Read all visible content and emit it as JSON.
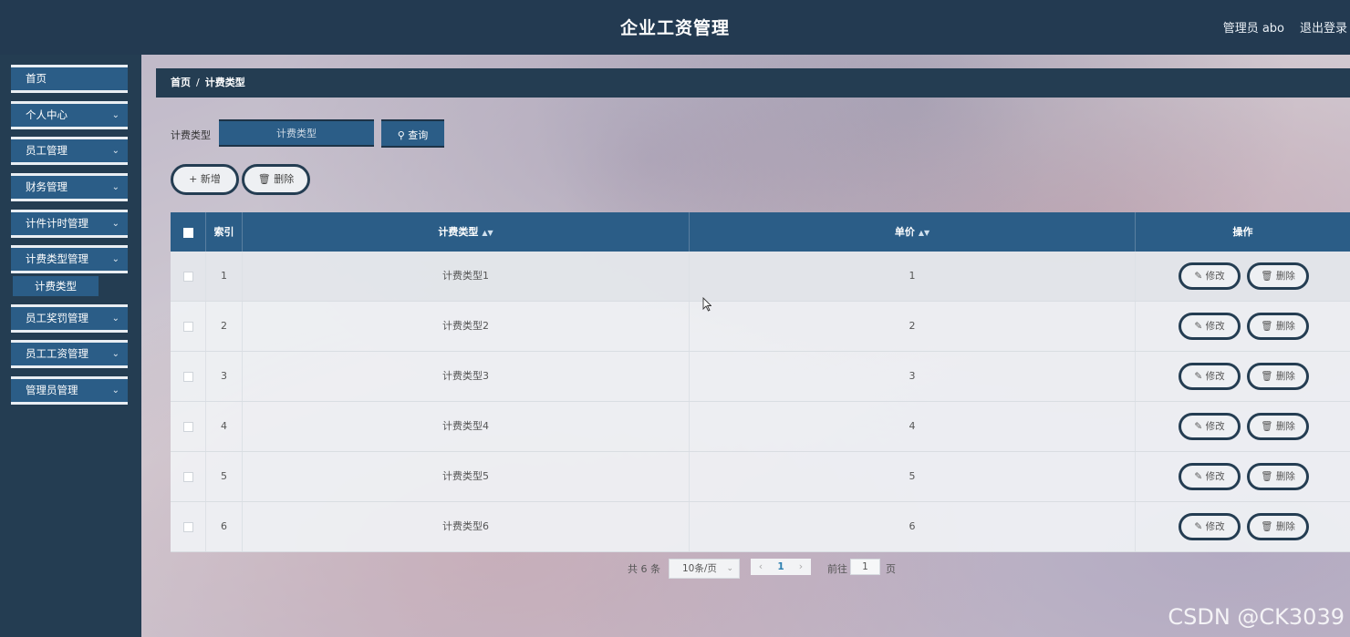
{
  "header": {
    "title": "企业工资管理",
    "user_label": "管理员 abo",
    "logout_label": "退出登录"
  },
  "sidebar": {
    "items": [
      {
        "label": "首页",
        "has_chevron": false
      },
      {
        "label": "个人中心",
        "has_chevron": true
      },
      {
        "label": "员工管理",
        "has_chevron": true
      },
      {
        "label": "财务管理",
        "has_chevron": true
      },
      {
        "label": "计件计时管理",
        "has_chevron": true
      },
      {
        "label": "计费类型管理",
        "has_chevron": true,
        "expanded": true
      },
      {
        "label": "员工奖罚管理",
        "has_chevron": true
      },
      {
        "label": "员工工资管理",
        "has_chevron": true
      },
      {
        "label": "管理员管理",
        "has_chevron": true
      }
    ],
    "submenu_active": "计费类型",
    "chevron_icon": "chevron-down-icon"
  },
  "breadcrumb": {
    "home": "首页",
    "separator": "/",
    "current": "计费类型"
  },
  "search": {
    "label": "计费类型",
    "placeholder": "计费类型",
    "value": "",
    "query_label": "查询"
  },
  "toolbar": {
    "add_label": "新增",
    "delete_label": "删除"
  },
  "table": {
    "columns": {
      "index": "索引",
      "type": "计费类型",
      "price": "单价",
      "ops": "操作"
    },
    "rows": [
      {
        "index": "1",
        "type": "计费类型1",
        "price": "1"
      },
      {
        "index": "2",
        "type": "计费类型2",
        "price": "2"
      },
      {
        "index": "3",
        "type": "计费类型3",
        "price": "3"
      },
      {
        "index": "4",
        "type": "计费类型4",
        "price": "4"
      },
      {
        "index": "5",
        "type": "计费类型5",
        "price": "5"
      },
      {
        "index": "6",
        "type": "计费类型6",
        "price": "6"
      }
    ],
    "edit_label": "修改",
    "delete_label": "删除"
  },
  "pagination": {
    "total": "共 6 条",
    "page_size": "10条/页",
    "prev": "‹",
    "current_page": "1",
    "next": "›",
    "goto_label": "前往",
    "goto_value": "1",
    "page_unit": "页"
  },
  "watermark": "CSDN @CK3039",
  "colors": {
    "header_bg": "#233a51",
    "accent": "#2b5d87",
    "sidebar_bg": "#243d52"
  }
}
